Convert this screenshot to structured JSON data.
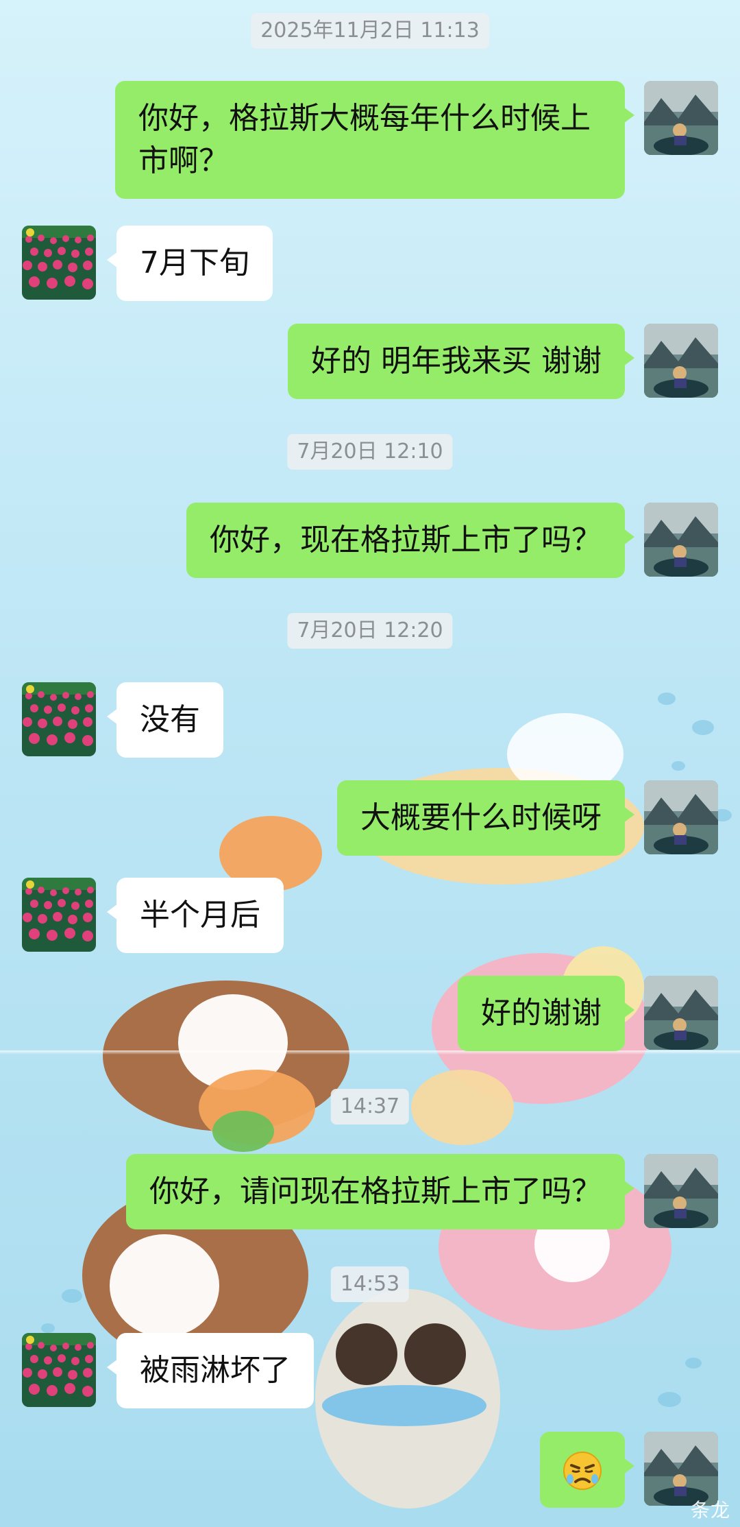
{
  "chat": {
    "timestamps": {
      "t1": "2025年11月2日 11:13",
      "t2": "7月20日 12:10",
      "t3": "7月20日 12:20",
      "t4": "14:37",
      "t5": "14:53"
    },
    "messages": {
      "m1": "你好，格拉斯大概每年什么时候上市啊？",
      "m2": "7月下旬",
      "m3": "好的 明年我来买 谢谢",
      "m4": "你好，现在格拉斯上市了吗？",
      "m5": "没有",
      "m6": "大概要什么时候呀",
      "m7": "半个月后",
      "m8": "好的谢谢",
      "m9": "你好，请问现在格拉斯上市了吗？",
      "m10": "被雨淋坏了",
      "m11_icon": "crying-face-emoji"
    },
    "avatars": {
      "mine_icon": "mountain-lake-boat-avatar",
      "theirs_icon": "tulip-field-avatar"
    },
    "colors": {
      "mine_bubble": "#95ec69",
      "theirs_bubble": "#ffffff",
      "background": "#bde6f5"
    }
  },
  "watermark": "条龙"
}
